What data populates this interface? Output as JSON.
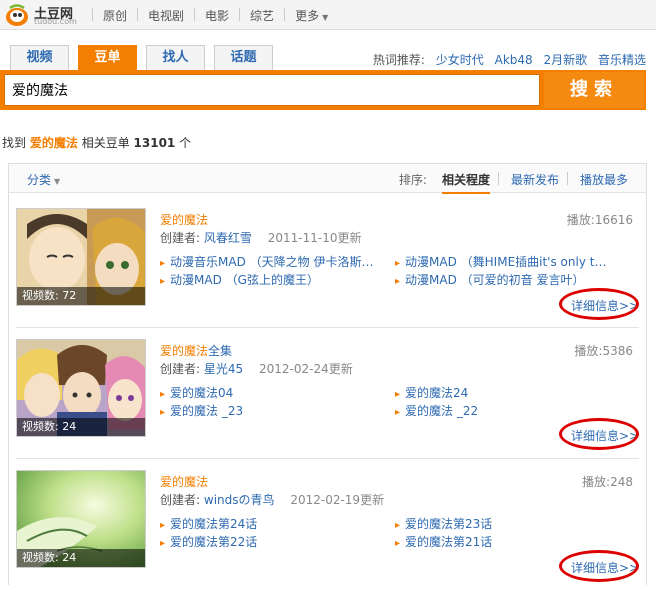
{
  "site": {
    "logo_text": "土豆网",
    "logo_sub": "tudou.com"
  },
  "topnav": [
    {
      "label": "原创"
    },
    {
      "label": "电视剧"
    },
    {
      "label": "电影"
    },
    {
      "label": "综艺"
    },
    {
      "label": "更多"
    }
  ],
  "tabs": [
    {
      "label": "视频",
      "active": false
    },
    {
      "label": "豆单",
      "active": true
    },
    {
      "label": "找人",
      "active": false
    },
    {
      "label": "话题",
      "active": false
    }
  ],
  "hot": {
    "label": "热词推荐:",
    "items": [
      "少女时代",
      "Akb48",
      "2月新歌",
      "音乐精选"
    ]
  },
  "search": {
    "value": "爱的魔法",
    "button": "搜索"
  },
  "result": {
    "prefix": "找到",
    "keyword": "爱的魔法",
    "mid": "相关豆单",
    "count": "13101",
    "suffix": "个"
  },
  "filter": {
    "category": "分类"
  },
  "sort": {
    "label": "排序:",
    "options": [
      {
        "label": "相关程度",
        "active": true
      },
      {
        "label": "最新发布",
        "active": false
      },
      {
        "label": "播放最多",
        "active": false
      }
    ]
  },
  "items": [
    {
      "title_kw": "爱的魔法",
      "title_rest": "",
      "creator_label": "创建者:",
      "creator": "风春红雪",
      "date": "2011-11-10更新",
      "plays": "播放:16616",
      "count": "视频数: 72",
      "videos": [
        "动漫音乐MAD （天降之物 伊卡洛斯…",
        "动漫MAD （舞HIME插曲it's only th…",
        "动漫MAD （G弦上的魔王）",
        "动漫MAD （可爱的初音 爱言叶）"
      ],
      "detail": "详细信息>>"
    },
    {
      "title_kw": "爱的魔法",
      "title_rest": "全集",
      "creator_label": "创建者:",
      "creator": "星光45",
      "date": "2012-02-24更新",
      "plays": "播放:5386",
      "count": "视频数: 24",
      "videos": [
        "爱的魔法04",
        "爱的魔法24",
        "爱的魔法 _23",
        "爱的魔法 _22"
      ],
      "detail": "详细信息>>"
    },
    {
      "title_kw": "爱的魔法",
      "title_rest": "",
      "creator_label": "创建者:",
      "creator": "windsの青鸟",
      "date": "2012-02-19更新",
      "plays": "播放:248",
      "count": "视频数: 24",
      "videos": [
        "爱的魔法第24话",
        "爱的魔法第23话",
        "爱的魔法第22话",
        "爱的魔法第21话"
      ],
      "detail": "详细信息>>"
    }
  ],
  "colors": {
    "accent": "#f37e00",
    "link": "#2e6ab1",
    "highlight_ring": "#dd0000"
  }
}
